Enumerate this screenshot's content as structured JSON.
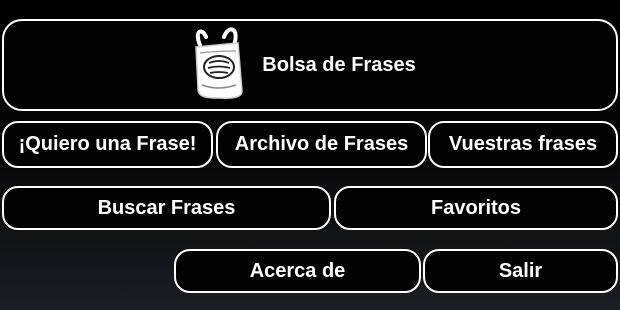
{
  "header": {
    "title": "Bolsa de Frases",
    "logo_icon": "shopping-bag-icon"
  },
  "menu": {
    "quiero_frase": "¡Quiero una Frase!",
    "archivo_frases": "Archivo de Frases",
    "vuestras_frases": "Vuestras frases",
    "buscar_frases": "Buscar Frases",
    "favoritos": "Favoritos",
    "acerca_de": "Acerca de",
    "salir": "Salir"
  },
  "colors": {
    "background": "#000000",
    "button_fill": "#020202",
    "button_border": "#ffffff",
    "text": "#ffffff"
  }
}
